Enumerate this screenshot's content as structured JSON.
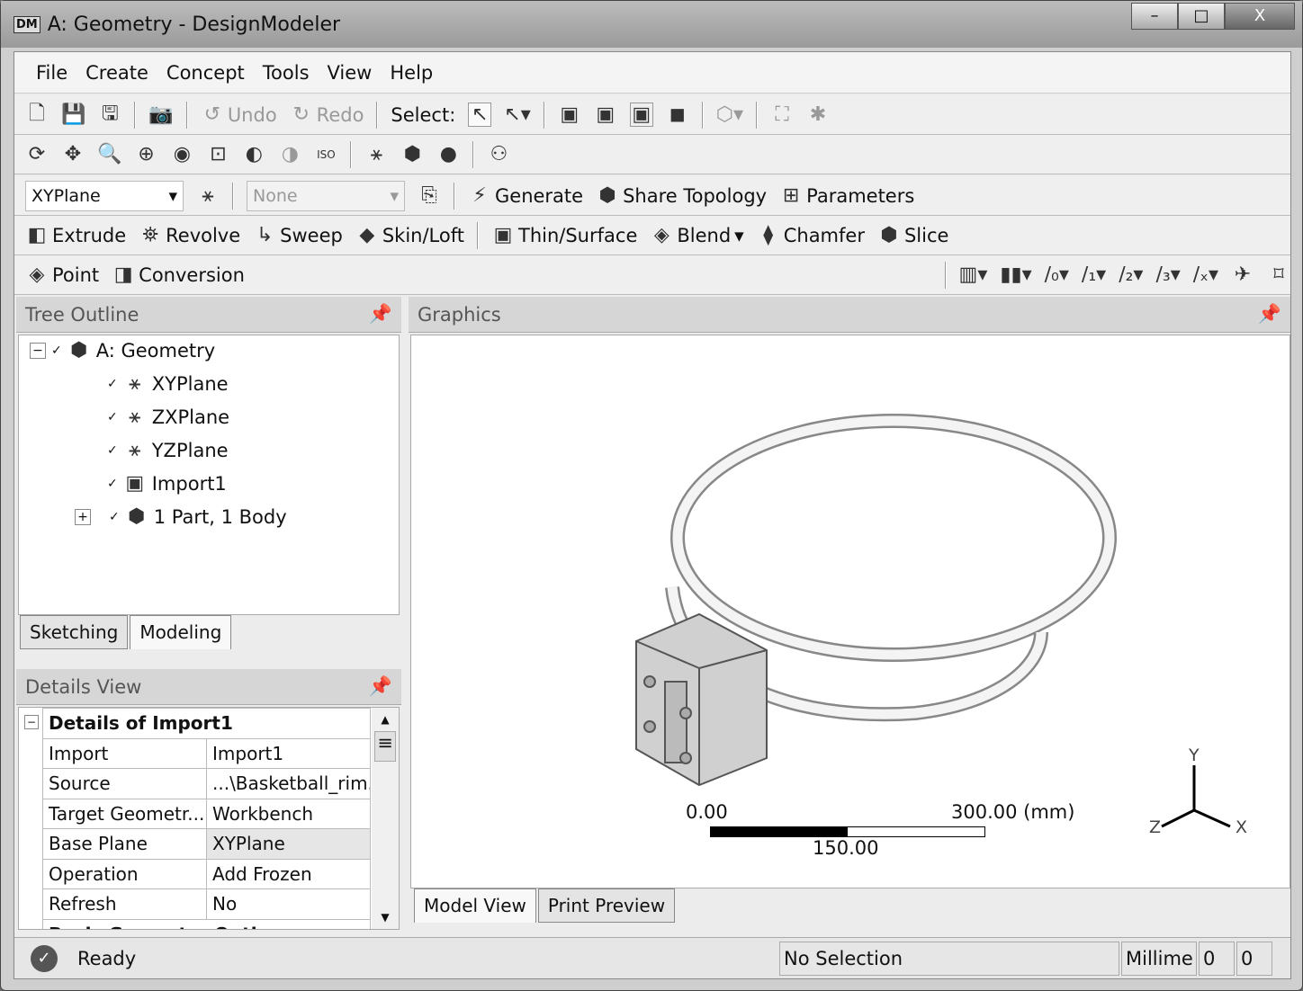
{
  "window": {
    "logo": "DM",
    "title": "A: Geometry - DesignModeler",
    "minimize": "–",
    "maximize": "□",
    "close": "X"
  },
  "menu": [
    "File",
    "Create",
    "Concept",
    "Tools",
    "View",
    "Help"
  ],
  "toolbar1": {
    "undo": "Undo",
    "redo": "Redo",
    "select": "Select:"
  },
  "toolbar3": {
    "plane": "XYPlane",
    "sketch": "None",
    "generate": "Generate",
    "share": "Share Topology",
    "parameters": "Parameters"
  },
  "toolbar4": [
    "Extrude",
    "Revolve",
    "Sweep",
    "Skin/Loft",
    "Thin/Surface",
    "Blend",
    "Chamfer",
    "Slice"
  ],
  "toolbar5": [
    "Point",
    "Conversion"
  ],
  "tree": {
    "title": "Tree Outline",
    "root": "A: Geometry",
    "items": [
      "XYPlane",
      "ZXPlane",
      "YZPlane",
      "Import1",
      "1 Part, 1 Body"
    ]
  },
  "left_tabs": [
    "Sketching",
    "Modeling"
  ],
  "details": {
    "title": "Details View",
    "header": "Details of Import1",
    "rows": [
      [
        "Import",
        "Import1"
      ],
      [
        "Source",
        "...\\Basketball_rim.S"
      ],
      [
        "Target Geometr...",
        "Workbench"
      ],
      [
        "Base Plane",
        "XYPlane"
      ],
      [
        "Operation",
        "Add Frozen"
      ],
      [
        "Refresh",
        "No"
      ]
    ],
    "next_group": "Basic Geometry Options"
  },
  "graphics": {
    "title": "Graphics",
    "scale_start": "0.00",
    "scale_end": "300.00 (mm)",
    "scale_mid": "150.00",
    "axis_y": "Y",
    "axis_x": "X",
    "axis_z": "Z"
  },
  "graphics_tabs": [
    "Model View",
    "Print Preview"
  ],
  "status": {
    "ready": "Ready",
    "selection": "No Selection",
    "units": "Millime",
    "v1": "0",
    "v2": "0"
  }
}
